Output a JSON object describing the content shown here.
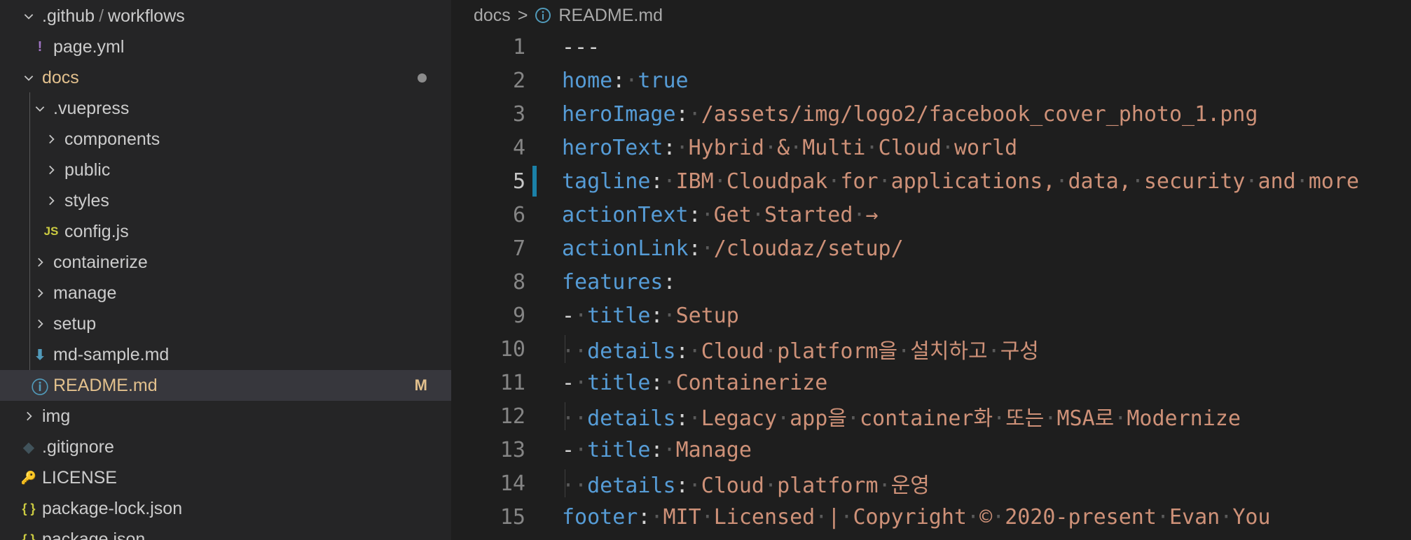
{
  "sidebar": {
    "rows": [
      {
        "chev": "down",
        "icon": "",
        "label": ".github",
        "extra": "workflows",
        "sep": "/",
        "indent": 0
      },
      {
        "chev": "",
        "icon": "yaml",
        "label": "page.yml",
        "indent": 1
      },
      {
        "chev": "down",
        "icon": "",
        "label": "docs",
        "indent": 0,
        "dot": true
      },
      {
        "chev": "down",
        "icon": "",
        "label": ".vuepress",
        "indent": 1
      },
      {
        "chev": "right",
        "icon": "",
        "label": "components",
        "indent": 2
      },
      {
        "chev": "right",
        "icon": "",
        "label": "public",
        "indent": 2
      },
      {
        "chev": "right",
        "icon": "",
        "label": "styles",
        "indent": 2
      },
      {
        "chev": "",
        "icon": "js",
        "label": "config.js",
        "indent": 2
      },
      {
        "chev": "right",
        "icon": "",
        "label": "containerize",
        "indent": 1
      },
      {
        "chev": "right",
        "icon": "",
        "label": "manage",
        "indent": 1
      },
      {
        "chev": "right",
        "icon": "",
        "label": "setup",
        "indent": 1
      },
      {
        "chev": "",
        "icon": "md",
        "label": "md-sample.md",
        "indent": 1
      },
      {
        "chev": "",
        "icon": "info",
        "label": "README.md",
        "indent": 1,
        "badge": "M",
        "selected": true
      },
      {
        "chev": "right",
        "icon": "",
        "label": "img",
        "indent": 0
      },
      {
        "chev": "",
        "icon": "git",
        "label": ".gitignore",
        "indent": 0
      },
      {
        "chev": "",
        "icon": "license",
        "label": "LICENSE",
        "indent": 0
      },
      {
        "chev": "",
        "icon": "json",
        "label": "package-lock.json",
        "indent": 0
      },
      {
        "chev": "",
        "icon": "json",
        "label": "package.json",
        "indent": 0
      }
    ],
    "icon_glyphs": {
      "yaml": "!",
      "js": "JS",
      "json": "{ }",
      "md": "⬇",
      "info": "ⓘ",
      "git": "◆",
      "license": "🔑"
    },
    "colors": {
      "yaml": "#a074c4",
      "js": "#cbcb41",
      "json": "#cbcb41",
      "md": "#519aba",
      "info": "#519aba",
      "git": "#41535b",
      "license": "#cbcb41",
      "modified": "#e2c08d",
      "folder_label": "#cccccc"
    }
  },
  "editor": {
    "breadcrumb": {
      "folder": "docs",
      "separator": ">",
      "file": "README.md"
    },
    "lines": [
      [
        [
          "p",
          "---"
        ]
      ],
      [
        [
          "k",
          "home"
        ],
        [
          "p",
          ":"
        ],
        [
          "w",
          "·"
        ],
        [
          "k",
          "true"
        ]
      ],
      [
        [
          "k",
          "heroImage"
        ],
        [
          "p",
          ":"
        ],
        [
          "w",
          "·"
        ],
        [
          "s",
          "/assets/img/logo2/facebook_cover_photo_1.png"
        ]
      ],
      [
        [
          "k",
          "heroText"
        ],
        [
          "p",
          ":"
        ],
        [
          "w",
          "·"
        ],
        [
          "s",
          "Hybrid"
        ],
        [
          "w",
          "·"
        ],
        [
          "s",
          "&"
        ],
        [
          "w",
          "·"
        ],
        [
          "s",
          "Multi"
        ],
        [
          "w",
          "·"
        ],
        [
          "s",
          "Cloud"
        ],
        [
          "w",
          "·"
        ],
        [
          "s",
          "world"
        ]
      ],
      [
        [
          "k",
          "tagline"
        ],
        [
          "p",
          ":"
        ],
        [
          "w",
          "·"
        ],
        [
          "s",
          "IBM"
        ],
        [
          "w",
          "·"
        ],
        [
          "s",
          "Cloudpak"
        ],
        [
          "w",
          "·"
        ],
        [
          "s",
          "for"
        ],
        [
          "w",
          "·"
        ],
        [
          "s",
          "applications,"
        ],
        [
          "w",
          "·"
        ],
        [
          "s",
          "data,"
        ],
        [
          "w",
          "·"
        ],
        [
          "s",
          "security"
        ],
        [
          "w",
          "·"
        ],
        [
          "s",
          "and"
        ],
        [
          "w",
          "·"
        ],
        [
          "s",
          "more"
        ]
      ],
      [
        [
          "k",
          "actionText"
        ],
        [
          "p",
          ":"
        ],
        [
          "w",
          "·"
        ],
        [
          "s",
          "Get"
        ],
        [
          "w",
          "·"
        ],
        [
          "s",
          "Started"
        ],
        [
          "w",
          "·"
        ],
        [
          "s",
          "→"
        ]
      ],
      [
        [
          "k",
          "actionLink"
        ],
        [
          "p",
          ":"
        ],
        [
          "w",
          "·"
        ],
        [
          "s",
          "/cloudaz/setup/"
        ]
      ],
      [
        [
          "k",
          "features"
        ],
        [
          "p",
          ":"
        ]
      ],
      [
        [
          "p",
          "-"
        ],
        [
          "w",
          "·"
        ],
        [
          "k",
          "title"
        ],
        [
          "p",
          ":"
        ],
        [
          "w",
          "·"
        ],
        [
          "s",
          "Setup"
        ]
      ],
      [
        [
          "w",
          "··"
        ],
        [
          "k",
          "details"
        ],
        [
          "p",
          ":"
        ],
        [
          "w",
          "·"
        ],
        [
          "s",
          "Cloud"
        ],
        [
          "w",
          "·"
        ],
        [
          "s",
          "platform을"
        ],
        [
          "w",
          "·"
        ],
        [
          "s",
          "설치하고"
        ],
        [
          "w",
          "·"
        ],
        [
          "s",
          "구성"
        ]
      ],
      [
        [
          "p",
          "-"
        ],
        [
          "w",
          "·"
        ],
        [
          "k",
          "title"
        ],
        [
          "p",
          ":"
        ],
        [
          "w",
          "·"
        ],
        [
          "s",
          "Containerize"
        ]
      ],
      [
        [
          "w",
          "··"
        ],
        [
          "k",
          "details"
        ],
        [
          "p",
          ":"
        ],
        [
          "w",
          "·"
        ],
        [
          "s",
          "Legacy"
        ],
        [
          "w",
          "·"
        ],
        [
          "s",
          "app을"
        ],
        [
          "w",
          "·"
        ],
        [
          "s",
          "container화"
        ],
        [
          "w",
          "·"
        ],
        [
          "s",
          "또는"
        ],
        [
          "w",
          "·"
        ],
        [
          "s",
          "MSA로"
        ],
        [
          "w",
          "·"
        ],
        [
          "s",
          "Modernize"
        ]
      ],
      [
        [
          "p",
          "-"
        ],
        [
          "w",
          "·"
        ],
        [
          "k",
          "title"
        ],
        [
          "p",
          ":"
        ],
        [
          "w",
          "·"
        ],
        [
          "s",
          "Manage"
        ]
      ],
      [
        [
          "w",
          "··"
        ],
        [
          "k",
          "details"
        ],
        [
          "p",
          ":"
        ],
        [
          "w",
          "·"
        ],
        [
          "s",
          "Cloud"
        ],
        [
          "w",
          "·"
        ],
        [
          "s",
          "platform"
        ],
        [
          "w",
          "·"
        ],
        [
          "s",
          "운영"
        ]
      ],
      [
        [
          "k",
          "footer"
        ],
        [
          "p",
          ":"
        ],
        [
          "w",
          "·"
        ],
        [
          "s",
          "MIT"
        ],
        [
          "w",
          "·"
        ],
        [
          "s",
          "Licensed"
        ],
        [
          "w",
          "·"
        ],
        [
          "s",
          "|"
        ],
        [
          "w",
          "·"
        ],
        [
          "s",
          "Copyright"
        ],
        [
          "w",
          "·"
        ],
        [
          "s",
          "©"
        ],
        [
          "w",
          "·"
        ],
        [
          "s",
          "2020-present"
        ],
        [
          "w",
          "·"
        ],
        [
          "s",
          "Evan"
        ],
        [
          "w",
          "·"
        ],
        [
          "s",
          "You"
        ]
      ]
    ],
    "line_numbers": [
      "1",
      "2",
      "3",
      "4",
      "5",
      "6",
      "7",
      "8",
      "9",
      "10",
      "11",
      "12",
      "13",
      "14",
      "15"
    ],
    "active_line": 5,
    "modified_line": 5
  }
}
